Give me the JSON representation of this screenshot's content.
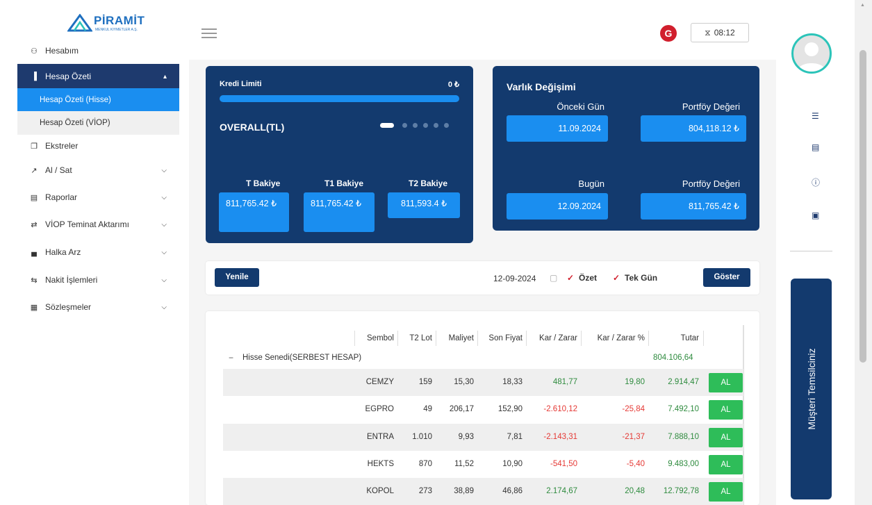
{
  "brand": {
    "name": "PİRAMİT",
    "subtitle": "MENKUL KIYMETLER A.Ş."
  },
  "sidebar": {
    "items": [
      {
        "label": "Hesabım",
        "icon": "user-icon"
      },
      {
        "label": "Hesap Özeti",
        "icon": "bar-chart-icon"
      },
      {
        "label": "Ekstreler",
        "icon": "copy-icon"
      },
      {
        "label": "Al / Sat",
        "icon": "trend-icon"
      },
      {
        "label": "Raporlar",
        "icon": "report-icon"
      },
      {
        "label": "VİOP Teminat Aktarımı",
        "icon": "transfer-icon"
      },
      {
        "label": "Halka Arz",
        "icon": "area-chart-icon"
      },
      {
        "label": "Nakit İşlemleri",
        "icon": "exchange-icon"
      },
      {
        "label": "Sözleşmeler",
        "icon": "contract-icon"
      }
    ],
    "subitems": [
      {
        "label": "Hesap Özeti (Hisse)"
      },
      {
        "label": "Hesap Özeti (VİOP)"
      }
    ]
  },
  "header": {
    "timer": "08:12",
    "logout_letter": "G"
  },
  "credit_card": {
    "kredi_label": "Kredi Limiti",
    "kredi_value": "0 ₺",
    "overall": "OVERALL(TL)",
    "balances": [
      {
        "label": "T Bakiye",
        "value": "811,765.42 ₺"
      },
      {
        "label": "T1 Bakiye",
        "value": "811,765.42 ₺"
      },
      {
        "label": "T2 Bakiye",
        "value": "811,593.4 ₺"
      }
    ]
  },
  "varlik": {
    "title": "Varlık Değişimi",
    "prev_label": "Önceki Gün",
    "prev_date": "11.09.2024",
    "prev_pf_label": "Portföy Değeri",
    "prev_pf_value": "804,118.12 ₺",
    "today_label": "Bugün",
    "today_date": "12.09.2024",
    "today_pf_label": "Portföy Değeri",
    "today_pf_value": "811,765.42 ₺"
  },
  "filter": {
    "refresh": "Yenile",
    "date": "12-09-2024",
    "ozet": "Özet",
    "tekgun": "Tek Gün",
    "show": "Göster"
  },
  "table": {
    "headers": [
      "Sembol",
      "T2 Lot",
      "Maliyet",
      "Son Fiyat",
      "Kar / Zarar",
      "Kar / Zarar %",
      "Tutar"
    ],
    "group_label": "Hisse Senedi(SERBEST HESAP)",
    "group_total": "804.106,64",
    "buy_label": "AL",
    "rows": [
      {
        "symbol": "CEMZY",
        "lot": "159",
        "cost": "15,30",
        "price": "18,33",
        "pl": "481,77",
        "plp": "19,80",
        "amount": "2.914,47"
      },
      {
        "symbol": "EGPRO",
        "lot": "49",
        "cost": "206,17",
        "price": "152,90",
        "pl": "-2.610,12",
        "plp": "-25,84",
        "amount": "7.492,10"
      },
      {
        "symbol": "ENTRA",
        "lot": "1.010",
        "cost": "9,93",
        "price": "7,81",
        "pl": "-2.143,31",
        "plp": "-21,37",
        "amount": "7.888,10"
      },
      {
        "symbol": "HEKTS",
        "lot": "870",
        "cost": "11,52",
        "price": "10,90",
        "pl": "-541,50",
        "plp": "-5,40",
        "amount": "9.483,00"
      },
      {
        "symbol": "KOPOL",
        "lot": "273",
        "cost": "38,89",
        "price": "46,86",
        "pl": "2.174,67",
        "plp": "20,48",
        "amount": "12.792,78"
      }
    ]
  },
  "right_panel": {
    "rep_label": "Müşteri Temsilciniz"
  },
  "colors": {
    "navy": "#133a6e",
    "blue": "#1a8ef0",
    "green": "#2ebd59",
    "red": "#e53935"
  }
}
